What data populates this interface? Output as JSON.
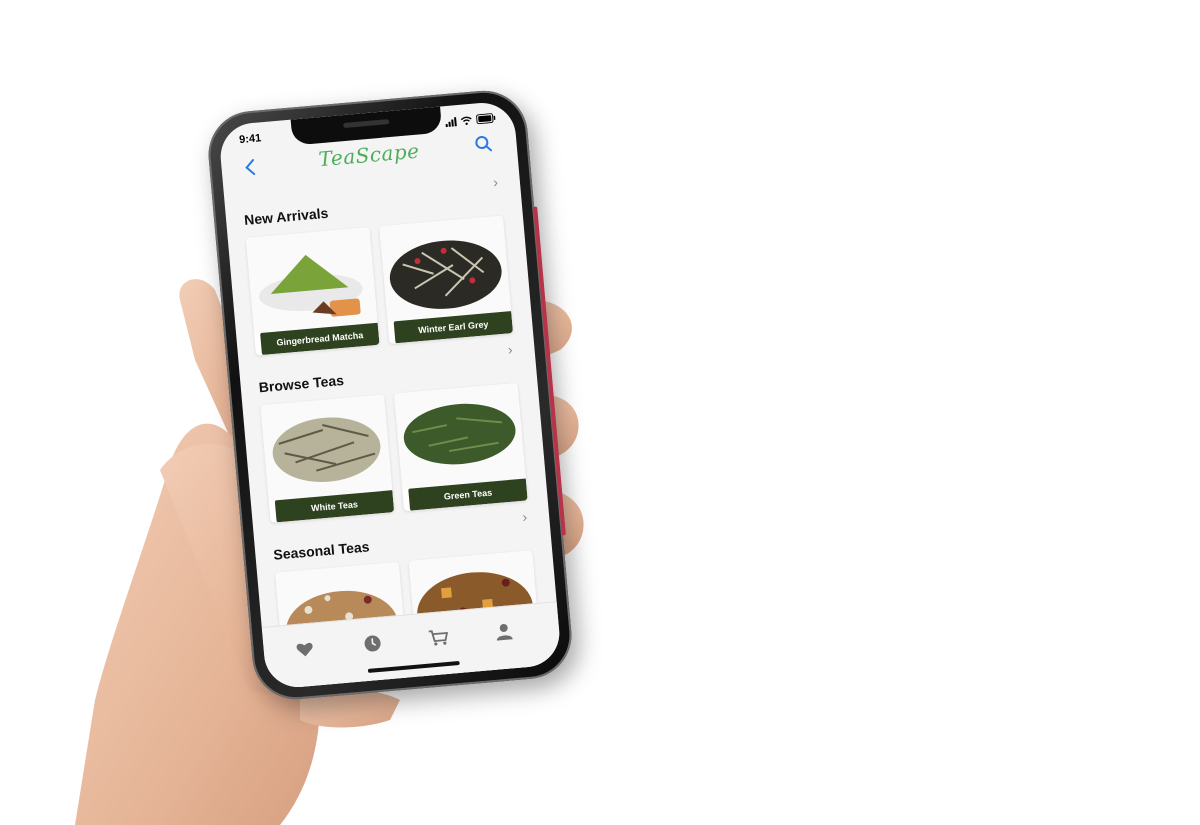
{
  "status_bar": {
    "time": "9:41"
  },
  "app": {
    "logo_text": "TeaScape"
  },
  "icons": {
    "back": "chevron-left-icon",
    "search": "search-icon",
    "section_more": "chevron-right-icon",
    "tabs": [
      "heart-icon",
      "clock-icon",
      "cart-icon",
      "user-icon"
    ]
  },
  "sections": [
    {
      "title": "New Arrivals",
      "items": [
        {
          "label": "Gingerbread Matcha"
        },
        {
          "label": "Winter Earl Grey"
        }
      ]
    },
    {
      "title": "Browse Teas",
      "items": [
        {
          "label": "White Teas"
        },
        {
          "label": "Green Teas"
        }
      ]
    },
    {
      "title": "Seasonal Teas",
      "items": []
    }
  ],
  "colors": {
    "accent": "#2a7ae2",
    "logo": "#4cae5a",
    "label_bg": "#2f4220",
    "phone_frame_accent": "#b8324a"
  }
}
